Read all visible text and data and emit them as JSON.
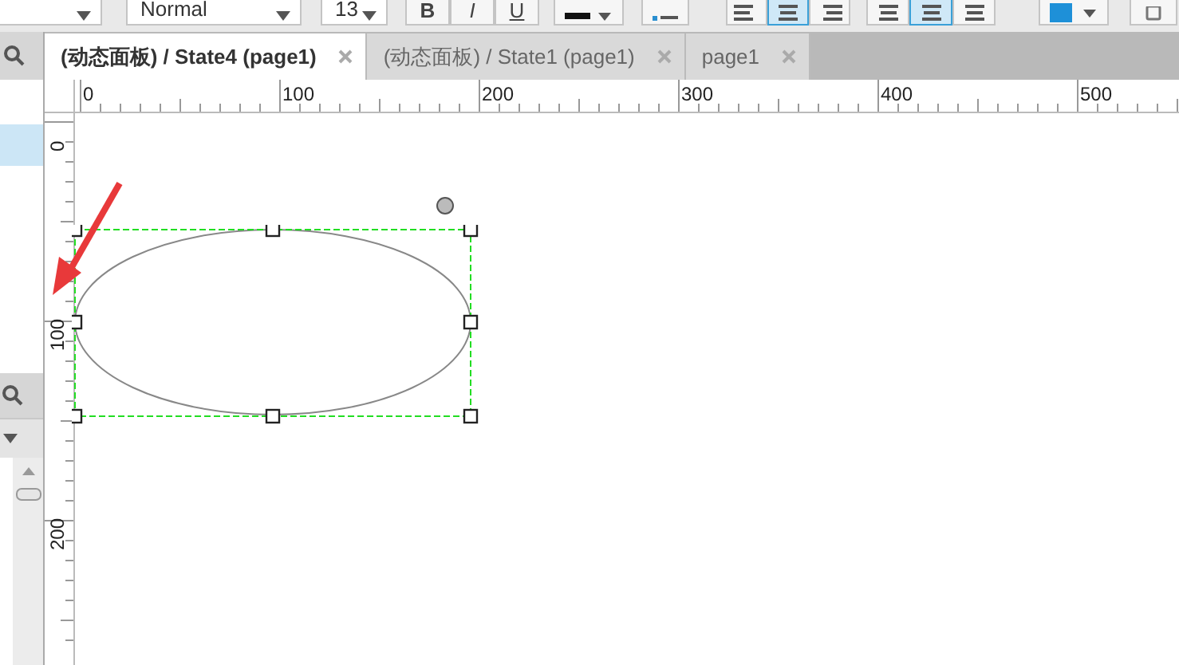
{
  "toolbar": {
    "style_dropdown": {
      "value": "Normal"
    },
    "size_dropdown": {
      "value": "13"
    },
    "format_buttons": [
      {
        "label": "B",
        "kind": "bold"
      },
      {
        "label": "I",
        "kind": "italic"
      },
      {
        "label": "U",
        "kind": "underline"
      }
    ],
    "align_buttons": [
      {
        "selected": false
      },
      {
        "selected": true
      },
      {
        "selected": false
      }
    ],
    "valign_buttons": [
      {
        "selected": false
      },
      {
        "selected": true
      },
      {
        "selected": false
      }
    ]
  },
  "left_panel": {
    "items": [
      {
        "selected": true
      }
    ]
  },
  "tabs": [
    {
      "label": "(动态面板) / State4 (page1)",
      "selected": true
    },
    {
      "label": "(动态面板) / State1 (page1)",
      "selected": false
    },
    {
      "label": "page1",
      "selected": false
    }
  ],
  "rulers": {
    "horizontal": [
      "0",
      "100",
      "200",
      "300",
      "400",
      "500"
    ],
    "vertical": [
      "0",
      "100",
      "200"
    ]
  }
}
